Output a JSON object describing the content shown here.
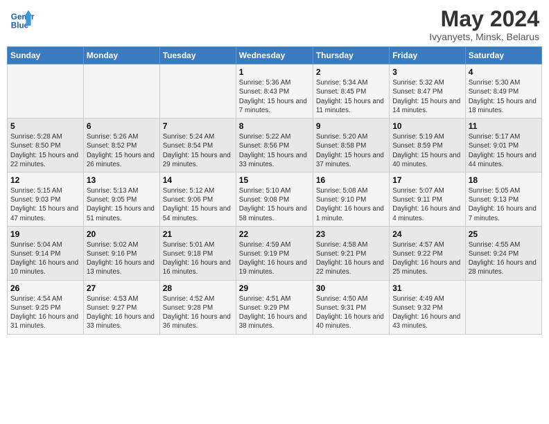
{
  "header": {
    "logo_line1": "General",
    "logo_line2": "Blue",
    "month": "May 2024",
    "location": "Ivyanyets, Minsk, Belarus"
  },
  "weekdays": [
    "Sunday",
    "Monday",
    "Tuesday",
    "Wednesday",
    "Thursday",
    "Friday",
    "Saturday"
  ],
  "weeks": [
    [
      {
        "num": "",
        "info": ""
      },
      {
        "num": "",
        "info": ""
      },
      {
        "num": "",
        "info": ""
      },
      {
        "num": "1",
        "info": "Sunrise: 5:36 AM\nSunset: 8:43 PM\nDaylight: 15 hours\nand 7 minutes."
      },
      {
        "num": "2",
        "info": "Sunrise: 5:34 AM\nSunset: 8:45 PM\nDaylight: 15 hours\nand 11 minutes."
      },
      {
        "num": "3",
        "info": "Sunrise: 5:32 AM\nSunset: 8:47 PM\nDaylight: 15 hours\nand 14 minutes."
      },
      {
        "num": "4",
        "info": "Sunrise: 5:30 AM\nSunset: 8:49 PM\nDaylight: 15 hours\nand 18 minutes."
      }
    ],
    [
      {
        "num": "5",
        "info": "Sunrise: 5:28 AM\nSunset: 8:50 PM\nDaylight: 15 hours\nand 22 minutes."
      },
      {
        "num": "6",
        "info": "Sunrise: 5:26 AM\nSunset: 8:52 PM\nDaylight: 15 hours\nand 26 minutes."
      },
      {
        "num": "7",
        "info": "Sunrise: 5:24 AM\nSunset: 8:54 PM\nDaylight: 15 hours\nand 29 minutes."
      },
      {
        "num": "8",
        "info": "Sunrise: 5:22 AM\nSunset: 8:56 PM\nDaylight: 15 hours\nand 33 minutes."
      },
      {
        "num": "9",
        "info": "Sunrise: 5:20 AM\nSunset: 8:58 PM\nDaylight: 15 hours\nand 37 minutes."
      },
      {
        "num": "10",
        "info": "Sunrise: 5:19 AM\nSunset: 8:59 PM\nDaylight: 15 hours\nand 40 minutes."
      },
      {
        "num": "11",
        "info": "Sunrise: 5:17 AM\nSunset: 9:01 PM\nDaylight: 15 hours\nand 44 minutes."
      }
    ],
    [
      {
        "num": "12",
        "info": "Sunrise: 5:15 AM\nSunset: 9:03 PM\nDaylight: 15 hours\nand 47 minutes."
      },
      {
        "num": "13",
        "info": "Sunrise: 5:13 AM\nSunset: 9:05 PM\nDaylight: 15 hours\nand 51 minutes."
      },
      {
        "num": "14",
        "info": "Sunrise: 5:12 AM\nSunset: 9:06 PM\nDaylight: 15 hours\nand 54 minutes."
      },
      {
        "num": "15",
        "info": "Sunrise: 5:10 AM\nSunset: 9:08 PM\nDaylight: 15 hours\nand 58 minutes."
      },
      {
        "num": "16",
        "info": "Sunrise: 5:08 AM\nSunset: 9:10 PM\nDaylight: 16 hours\nand 1 minute."
      },
      {
        "num": "17",
        "info": "Sunrise: 5:07 AM\nSunset: 9:11 PM\nDaylight: 16 hours\nand 4 minutes."
      },
      {
        "num": "18",
        "info": "Sunrise: 5:05 AM\nSunset: 9:13 PM\nDaylight: 16 hours\nand 7 minutes."
      }
    ],
    [
      {
        "num": "19",
        "info": "Sunrise: 5:04 AM\nSunset: 9:14 PM\nDaylight: 16 hours\nand 10 minutes."
      },
      {
        "num": "20",
        "info": "Sunrise: 5:02 AM\nSunset: 9:16 PM\nDaylight: 16 hours\nand 13 minutes."
      },
      {
        "num": "21",
        "info": "Sunrise: 5:01 AM\nSunset: 9:18 PM\nDaylight: 16 hours\nand 16 minutes."
      },
      {
        "num": "22",
        "info": "Sunrise: 4:59 AM\nSunset: 9:19 PM\nDaylight: 16 hours\nand 19 minutes."
      },
      {
        "num": "23",
        "info": "Sunrise: 4:58 AM\nSunset: 9:21 PM\nDaylight: 16 hours\nand 22 minutes."
      },
      {
        "num": "24",
        "info": "Sunrise: 4:57 AM\nSunset: 9:22 PM\nDaylight: 16 hours\nand 25 minutes."
      },
      {
        "num": "25",
        "info": "Sunrise: 4:55 AM\nSunset: 9:24 PM\nDaylight: 16 hours\nand 28 minutes."
      }
    ],
    [
      {
        "num": "26",
        "info": "Sunrise: 4:54 AM\nSunset: 9:25 PM\nDaylight: 16 hours\nand 31 minutes."
      },
      {
        "num": "27",
        "info": "Sunrise: 4:53 AM\nSunset: 9:27 PM\nDaylight: 16 hours\nand 33 minutes."
      },
      {
        "num": "28",
        "info": "Sunrise: 4:52 AM\nSunset: 9:28 PM\nDaylight: 16 hours\nand 36 minutes."
      },
      {
        "num": "29",
        "info": "Sunrise: 4:51 AM\nSunset: 9:29 PM\nDaylight: 16 hours\nand 38 minutes."
      },
      {
        "num": "30",
        "info": "Sunrise: 4:50 AM\nSunset: 9:31 PM\nDaylight: 16 hours\nand 40 minutes."
      },
      {
        "num": "31",
        "info": "Sunrise: 4:49 AM\nSunset: 9:32 PM\nDaylight: 16 hours\nand 43 minutes."
      },
      {
        "num": "",
        "info": ""
      }
    ]
  ]
}
